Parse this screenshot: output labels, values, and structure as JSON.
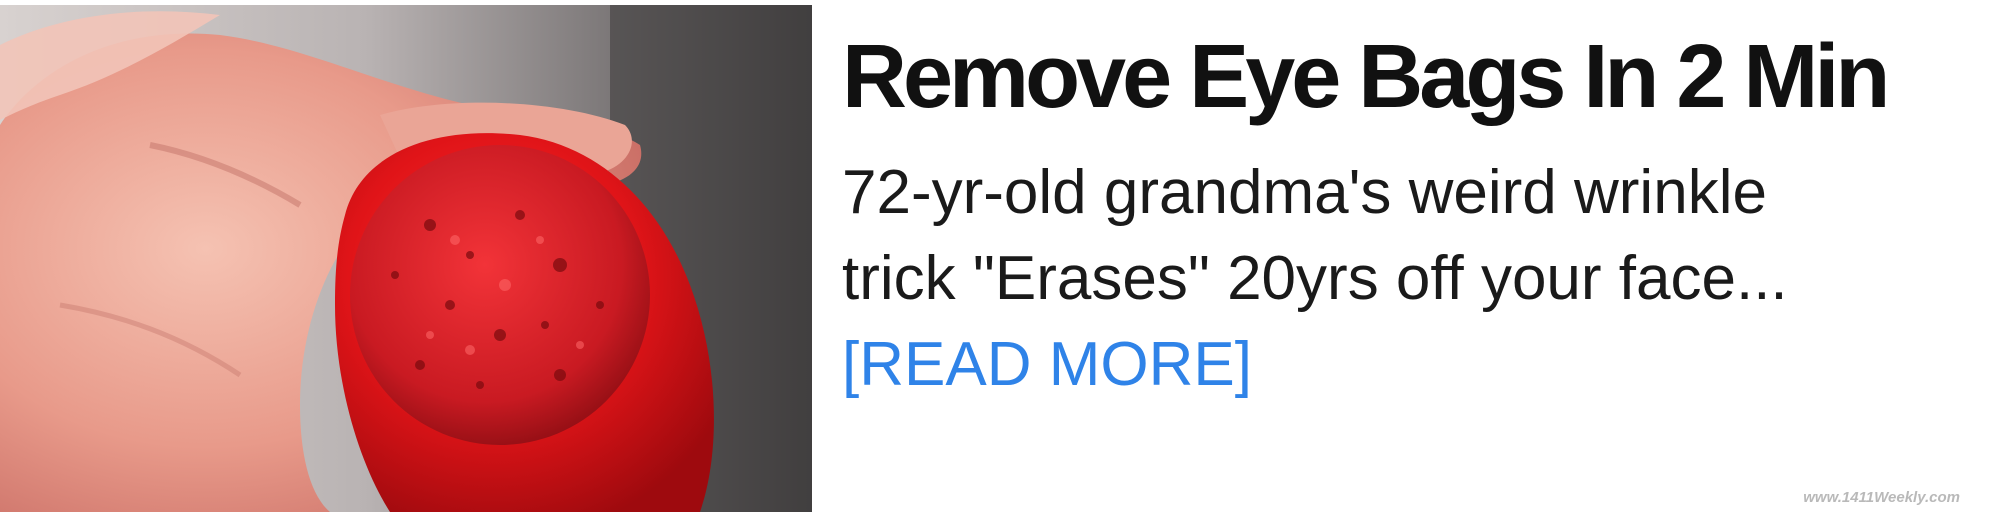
{
  "ad": {
    "headline": "Remove Eye Bags In 2 Min",
    "body_line1": "72-yr-old grandma's weird wrinkle",
    "body_line2": "trick \"Erases\" 20yrs off your face...",
    "cta": "[READ MORE]",
    "watermark": "www.1411Weekly.com",
    "image_icon": "hand-holding-red-potato-image"
  },
  "colors": {
    "headline": "#111111",
    "body": "#1a1a1a",
    "cta": "#2f83e8",
    "watermark": "#b9b9b9",
    "background": "#ffffff"
  }
}
